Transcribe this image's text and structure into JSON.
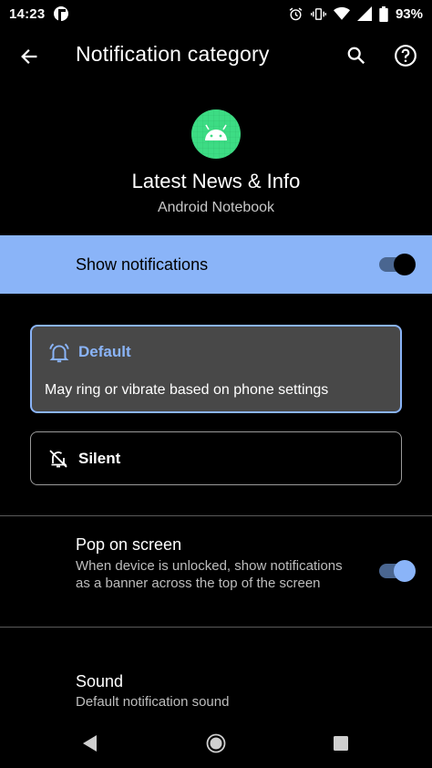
{
  "status_bar": {
    "time": "14:23",
    "battery_percent": "93%",
    "icons": [
      "alarm-icon",
      "vibrate-icon",
      "wifi-icon",
      "signal-icon",
      "battery-icon"
    ]
  },
  "app_bar": {
    "title": "Notification category",
    "icons": {
      "back": "back-arrow-icon",
      "search": "search-icon",
      "help": "help-icon"
    }
  },
  "header": {
    "channel_name": "Latest News & Info",
    "app_name": "Android Notebook",
    "app_icon": "android-robot-icon"
  },
  "show_notifications": {
    "label": "Show notifications",
    "enabled": true
  },
  "options": {
    "default": {
      "label": "Default",
      "description": "May ring or vibrate based on phone settings",
      "selected": true
    },
    "silent": {
      "label": "Silent",
      "selected": false
    }
  },
  "pop_on_screen": {
    "title": "Pop on screen",
    "summary": "When device is unlocked, show notifications as a banner across the top of the screen",
    "enabled": true
  },
  "sound": {
    "title": "Sound",
    "summary": "Default notification sound"
  },
  "colors": {
    "accent": "#8ab4f8",
    "background": "#000000",
    "card_selected": "#484848",
    "android_green": "#3ddc84"
  }
}
